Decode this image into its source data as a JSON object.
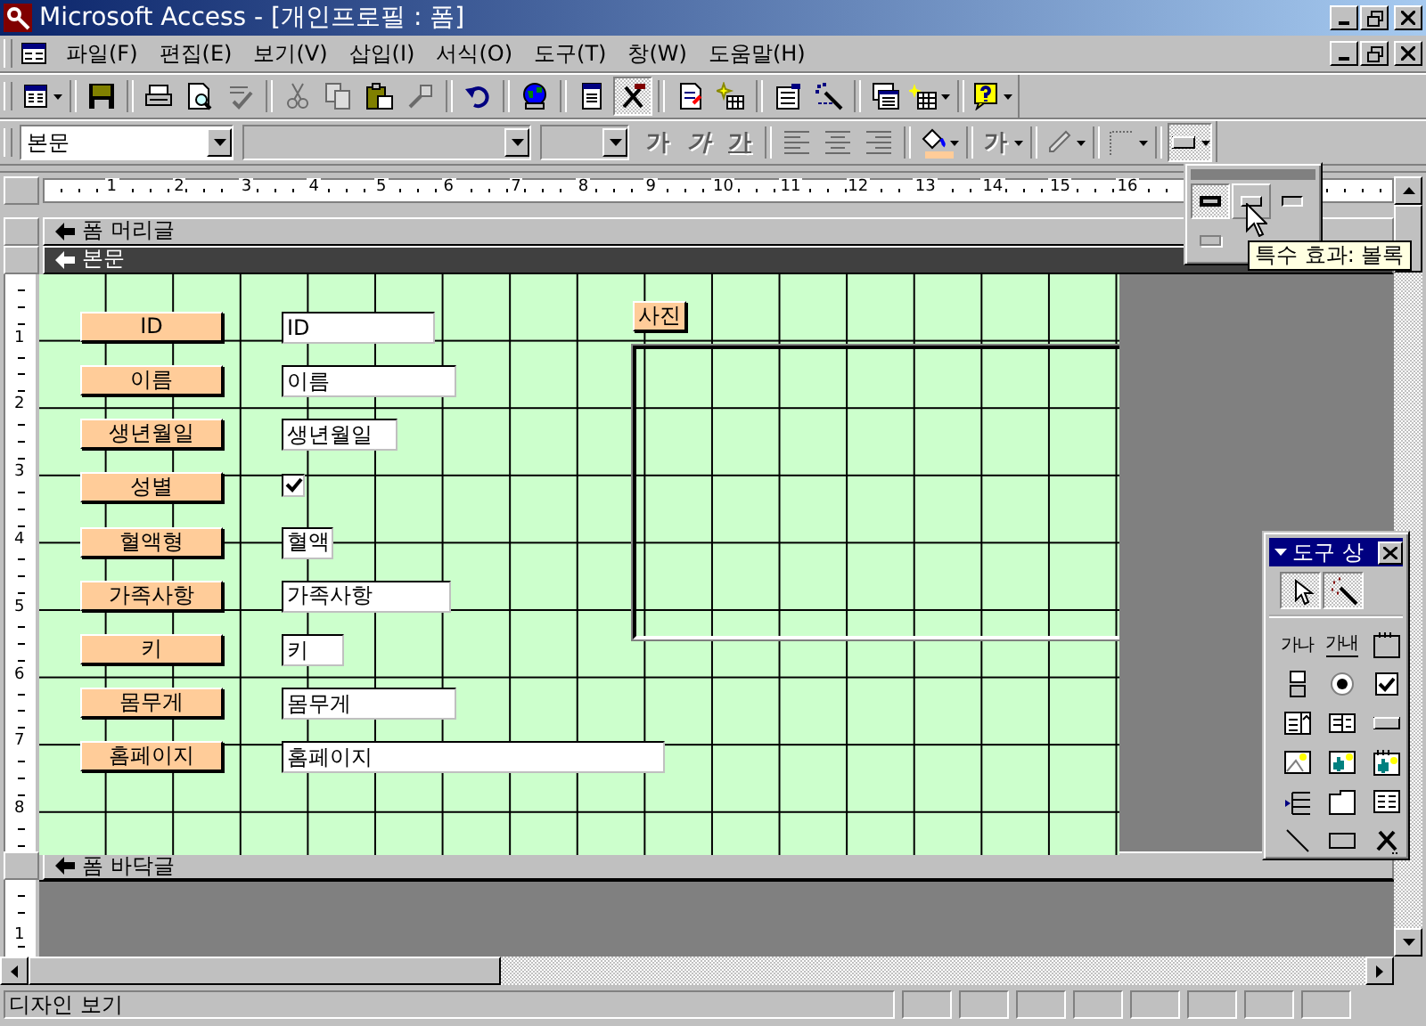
{
  "window": {
    "title": "Microsoft Access - [개인프로필 : 폼]"
  },
  "menu": [
    "파일(F)",
    "편집(E)",
    "보기(V)",
    "삽입(I)",
    "서식(O)",
    "도구(T)",
    "창(W)",
    "도움말(H)"
  ],
  "toolbar": [
    [
      {
        "kind": "view",
        "disabled": false,
        "pressed": false,
        "dropdown": true
      }
    ],
    [
      {
        "kind": "save",
        "disabled": false,
        "pressed": false,
        "dropdown": false
      }
    ],
    [
      {
        "kind": "print",
        "disabled": false,
        "pressed": false,
        "dropdown": false
      },
      {
        "kind": "preview",
        "disabled": false,
        "pressed": false,
        "dropdown": false
      },
      {
        "kind": "spell",
        "disabled": true,
        "pressed": false,
        "dropdown": false
      }
    ],
    [
      {
        "kind": "cut",
        "disabled": true,
        "pressed": false,
        "dropdown": false
      },
      {
        "kind": "copy",
        "disabled": true,
        "pressed": false,
        "dropdown": false
      },
      {
        "kind": "paste",
        "disabled": false,
        "pressed": false,
        "dropdown": false
      },
      {
        "kind": "painter",
        "disabled": true,
        "pressed": false,
        "dropdown": false
      }
    ],
    [
      {
        "kind": "undo",
        "disabled": false,
        "pressed": false,
        "dropdown": false
      }
    ],
    [
      {
        "kind": "web",
        "disabled": false,
        "pressed": false,
        "dropdown": false
      }
    ],
    [
      {
        "kind": "fieldlist",
        "disabled": false,
        "pressed": false,
        "dropdown": false
      },
      {
        "kind": "toolbox",
        "disabled": false,
        "pressed": true,
        "dropdown": false
      }
    ],
    [
      {
        "kind": "code",
        "disabled": false,
        "pressed": false,
        "dropdown": false
      },
      {
        "kind": "autoformat",
        "disabled": false,
        "pressed": false,
        "dropdown": false
      }
    ],
    [
      {
        "kind": "properties",
        "disabled": false,
        "pressed": false,
        "dropdown": false
      },
      {
        "kind": "build",
        "disabled": false,
        "pressed": false,
        "dropdown": false
      }
    ],
    [
      {
        "kind": "dbwindow",
        "disabled": false,
        "pressed": false,
        "dropdown": false
      },
      {
        "kind": "newobject",
        "disabled": false,
        "pressed": false,
        "dropdown": true
      }
    ],
    [
      {
        "kind": "help",
        "disabled": false,
        "pressed": false,
        "dropdown": true
      }
    ]
  ],
  "format_toolbar": {
    "object_box": "본문",
    "font_boxes": [
      {
        "disabled": true
      },
      {
        "disabled": true
      }
    ],
    "tools": [
      [
        {
          "kind": "bold",
          "label": "가",
          "disabled": true,
          "dropdown": false
        },
        {
          "kind": "italic",
          "label": "가",
          "disabled": true,
          "dropdown": false
        },
        {
          "kind": "underline",
          "label": "가",
          "disabled": true,
          "dropdown": false
        }
      ],
      [
        {
          "kind": "align-left",
          "disabled": true,
          "dropdown": false
        },
        {
          "kind": "align-center",
          "disabled": true,
          "dropdown": false
        },
        {
          "kind": "align-right",
          "disabled": true,
          "dropdown": false
        }
      ],
      [
        {
          "kind": "fill-color",
          "color": "#ffcc99",
          "disabled": false,
          "dropdown": true
        }
      ],
      [
        {
          "kind": "font-color",
          "label": "가",
          "disabled": true,
          "dropdown": true
        }
      ],
      [
        {
          "kind": "line-color",
          "disabled": true,
          "dropdown": true
        }
      ],
      [
        {
          "kind": "border-width",
          "disabled": true,
          "dropdown": true
        }
      ],
      [
        {
          "kind": "special-effect",
          "disabled": false,
          "pressed": true,
          "dropdown": true
        }
      ]
    ]
  },
  "ruler": {
    "marks": [
      "1",
      "2",
      "3",
      "4",
      "5",
      "6",
      "7",
      "8",
      "9",
      "10",
      "11",
      "12",
      "13",
      "14",
      "15",
      "16"
    ]
  },
  "vertical_ruler": {
    "marks": [
      "1",
      "2",
      "3",
      "4",
      "5",
      "6",
      "7",
      "8"
    ],
    "footer_marks": [
      "1"
    ]
  },
  "sections": [
    {
      "title": "폼 머리글",
      "selected": false
    },
    {
      "title": "본문",
      "selected": true
    },
    {
      "title": "폼 바닥글",
      "selected": false
    }
  ],
  "form_rows": [
    {
      "label": "ID",
      "field": {
        "kind": "textbox",
        "text": "ID"
      }
    },
    {
      "label": "이름",
      "field": {
        "kind": "textbox",
        "text": "이름"
      }
    },
    {
      "label": "생년월일",
      "field": {
        "kind": "textbox",
        "text": "생년월일"
      }
    },
    {
      "label": "성별",
      "field": {
        "kind": "checkbox",
        "checked": true
      }
    },
    {
      "label": "혈액형",
      "field": {
        "kind": "textbox",
        "text": "혈액"
      }
    },
    {
      "label": "가족사항",
      "field": {
        "kind": "textbox",
        "text": "가족사항"
      }
    },
    {
      "label": "키",
      "field": {
        "kind": "textbox",
        "text": "키"
      }
    },
    {
      "label": "몸무게",
      "field": {
        "kind": "textbox",
        "text": "몸무게"
      }
    },
    {
      "label": "홈페이지",
      "field": {
        "kind": "textbox",
        "text": "홈페이지"
      }
    }
  ],
  "photo": {
    "label": "사진"
  },
  "effect_palette": {
    "options": [
      {
        "kind": "flat",
        "selected": true,
        "hovered": false
      },
      {
        "kind": "raised",
        "selected": false,
        "hovered": true
      },
      {
        "kind": "sunken",
        "selected": false,
        "hovered": false
      },
      {
        "kind": "etched",
        "selected": false,
        "hovered": false
      }
    ],
    "tooltip": "특수 효과: 볼록"
  },
  "toolbox": {
    "title": "도구 상",
    "top_tools": [
      {
        "kind": "pointer",
        "selected": true
      },
      {
        "kind": "wizard",
        "selected": true
      }
    ],
    "tools": [
      {
        "kind": "label",
        "label": "가나"
      },
      {
        "kind": "textbox",
        "label": "가내"
      },
      {
        "kind": "group"
      },
      {
        "kind": "toggle"
      },
      {
        "kind": "radio"
      },
      {
        "kind": "checkbox"
      },
      {
        "kind": "combo"
      },
      {
        "kind": "list"
      },
      {
        "kind": "command"
      },
      {
        "kind": "image"
      },
      {
        "kind": "unbound"
      },
      {
        "kind": "bound"
      },
      {
        "kind": "pagebreak"
      },
      {
        "kind": "tab"
      },
      {
        "kind": "subform"
      },
      {
        "kind": "line"
      },
      {
        "kind": "rect"
      },
      {
        "kind": "more"
      }
    ]
  },
  "status_bar": {
    "text": "디자인 보기"
  }
}
